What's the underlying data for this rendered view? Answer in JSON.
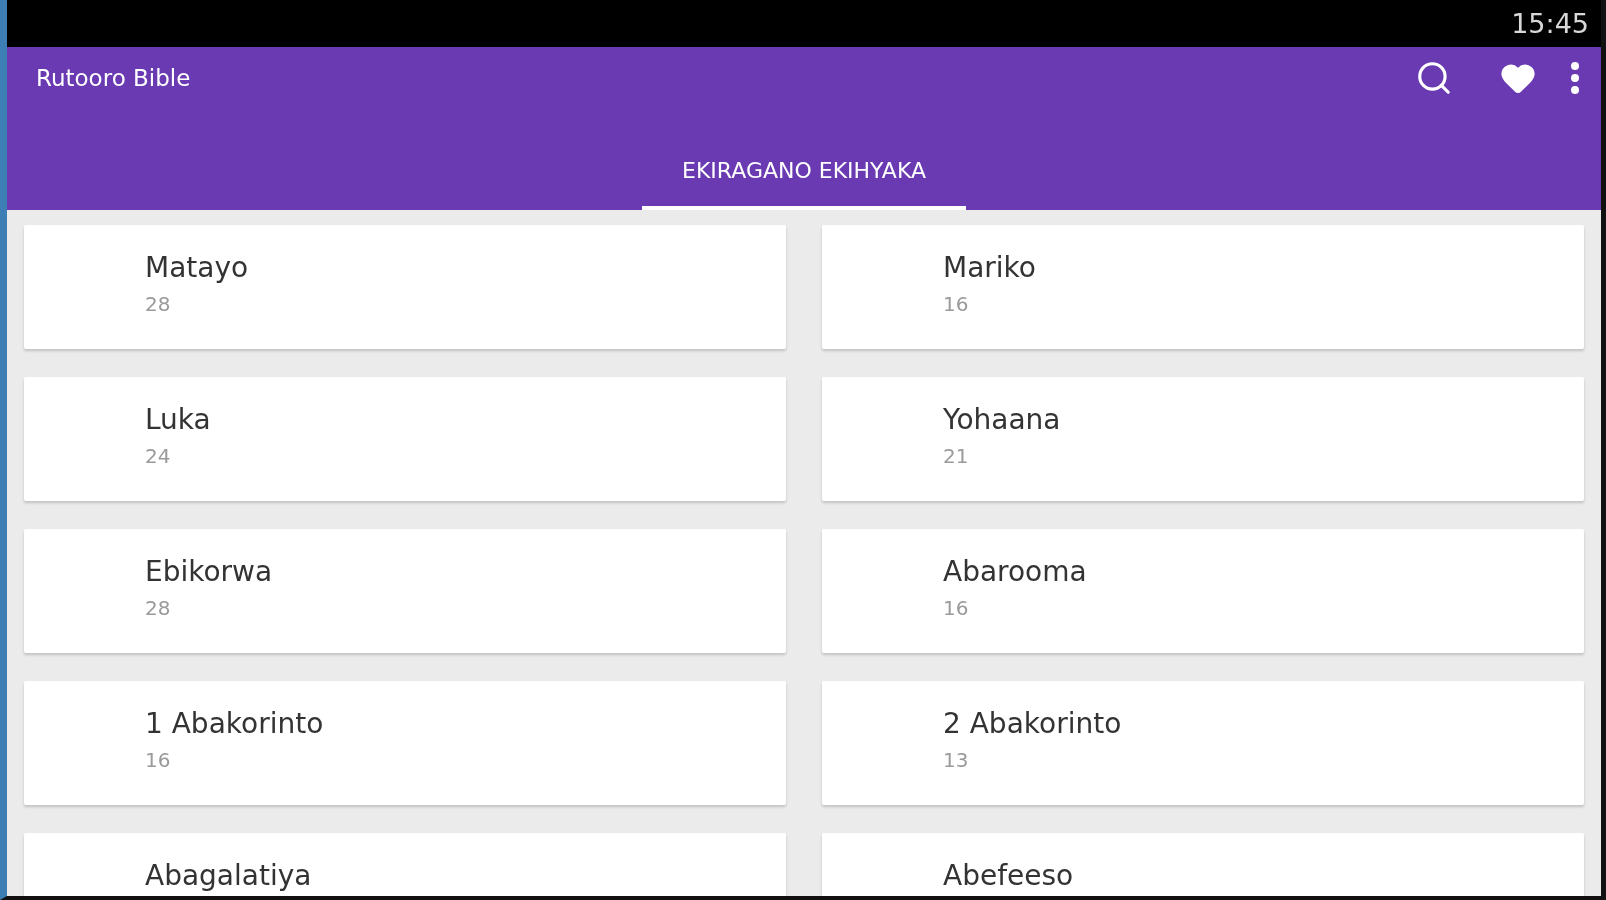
{
  "status_bar": {
    "time": "15:45"
  },
  "app_bar": {
    "title": "Rutooro Bible"
  },
  "tabs": [
    {
      "label": "EKIRAGANO EKIHYAKA",
      "selected": true
    }
  ],
  "books": [
    {
      "name": "Matayo",
      "chapters": "28"
    },
    {
      "name": "Mariko",
      "chapters": "16"
    },
    {
      "name": "Luka",
      "chapters": "24"
    },
    {
      "name": "Yohaana",
      "chapters": "21"
    },
    {
      "name": "Ebikorwa",
      "chapters": "28"
    },
    {
      "name": "Abarooma",
      "chapters": "16"
    },
    {
      "name": "1 Abakorinto",
      "chapters": "16"
    },
    {
      "name": "2 Abakorinto",
      "chapters": "13"
    },
    {
      "name": "Abagalatiya"
    },
    {
      "name": "Abefeeso"
    }
  ]
}
